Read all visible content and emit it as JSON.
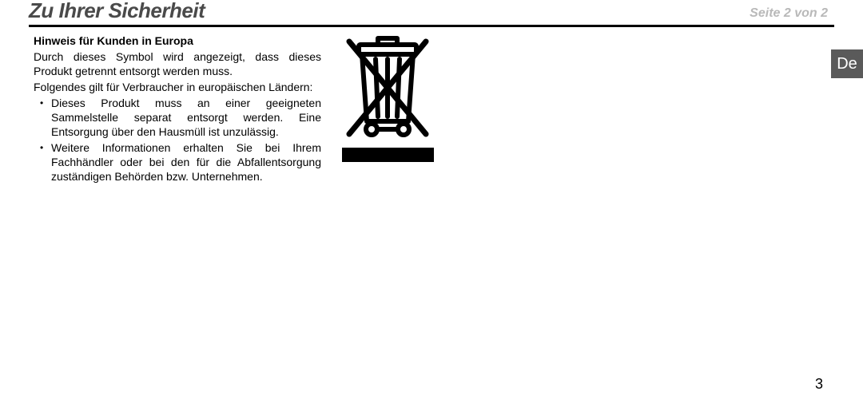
{
  "titlebar": {
    "title": "Zu Ihrer Sicherheit",
    "page_indicator": "Seite 2 von 2"
  },
  "lang_tab": "De",
  "page_number": "3",
  "section": {
    "heading": "Hinweis für Kunden in Europa",
    "para1": "Durch dieses Symbol wird angezeigt, dass dieses Produkt getrennt entsorgt werden muss.",
    "para2": "Folgendes gilt für Verbraucher in europäischen Ländern:",
    "bullets": [
      "Dieses Produkt muss an einer geeigneten Sammelstelle separat entsorgt werden. Eine Entsorgung über den Hausmüll ist unzulässig.",
      "Weitere Informationen erhalten Sie bei Ihrem Fachhändler oder bei den für die Abfallentsorgung zuständigen Behörden bzw. Unternehmen."
    ]
  },
  "icon_name": "weee-crossed-bin-icon"
}
